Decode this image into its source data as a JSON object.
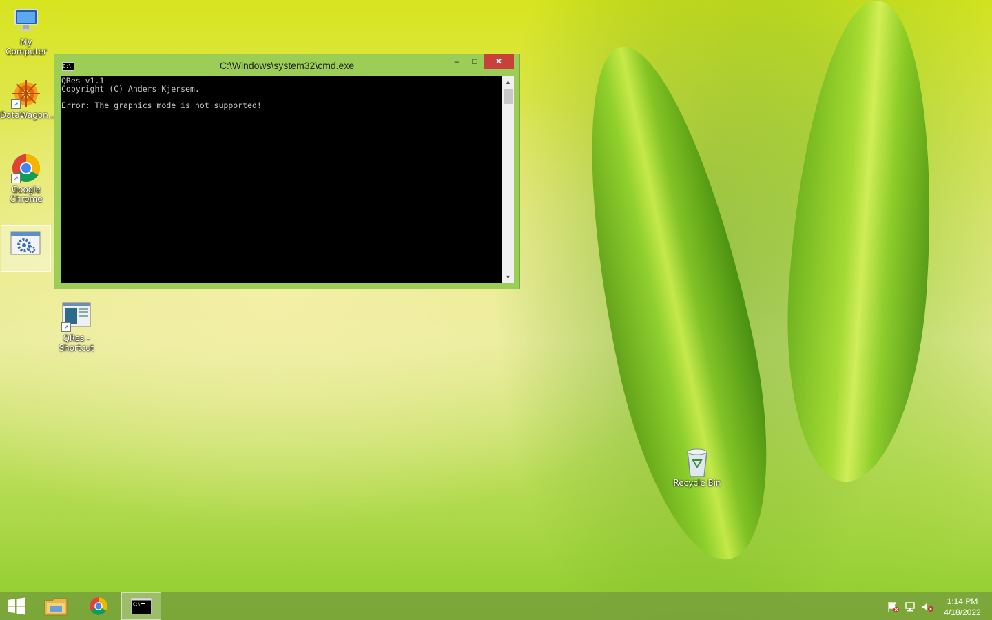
{
  "desktop": {
    "icons": [
      {
        "label": "My\nComputer",
        "name": "my-computer"
      },
      {
        "label": "DataWagon...",
        "name": "datawagon"
      },
      {
        "label": "Google\nChrome",
        "name": "google-chrome"
      },
      {
        "label": "QRes -\nShortcut",
        "name": "qres-shortcut"
      },
      {
        "label": "Recycle Bin",
        "name": "recycle-bin"
      }
    ]
  },
  "cmd_window": {
    "title": "C:\\Windows\\system32\\cmd.exe",
    "app_icon_text": "C:\\",
    "minimize_glyph": "–",
    "maximize_glyph": "□",
    "close_glyph": "✕",
    "console_lines": [
      "QRes v1.1",
      "Copyright (C) Anders Kjersem.",
      "",
      "Error: The graphics mode is not supported!",
      "_"
    ]
  },
  "taskbar": {
    "start": "windows-logo-icon",
    "pinned": [
      "file-explorer-icon",
      "chrome-icon",
      "cmd-icon"
    ],
    "clock": {
      "time": "1:14 PM",
      "date": "4/18/2022"
    }
  },
  "colors": {
    "titlebar": "#9ccd57",
    "close": "#c7403a",
    "console_bg": "#000000",
    "console_fg": "#c8c8c8"
  }
}
